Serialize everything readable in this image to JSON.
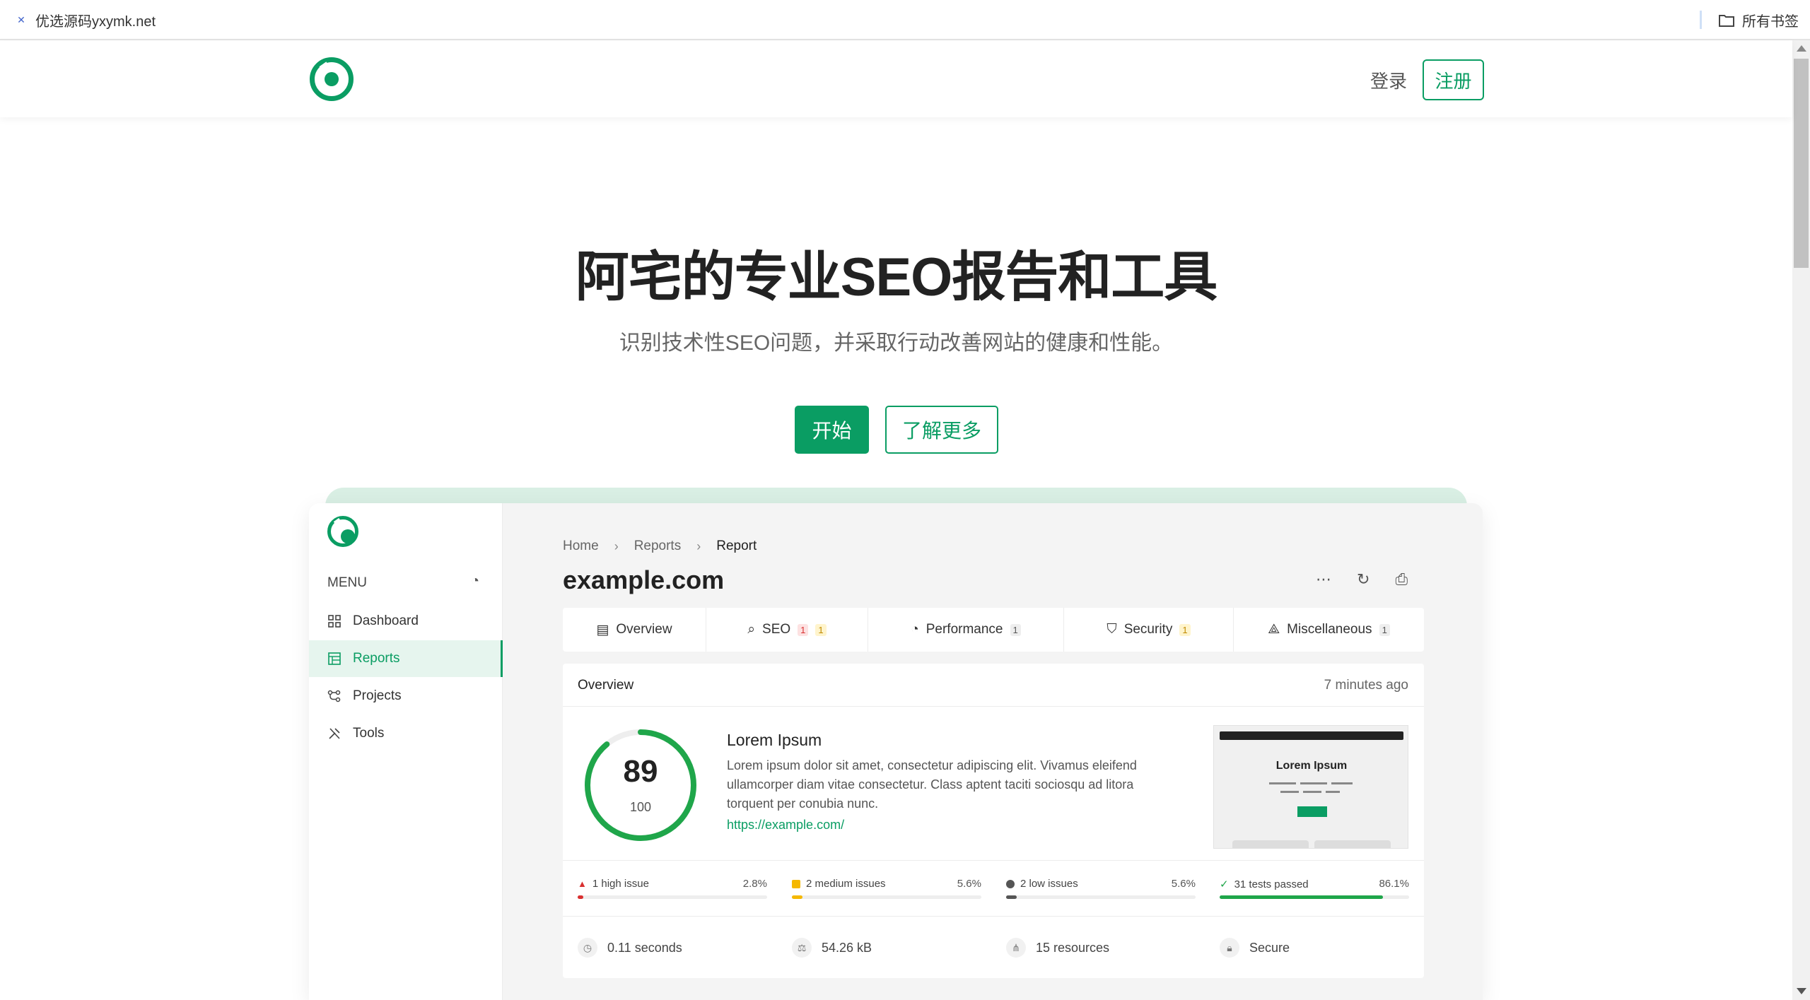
{
  "browser": {
    "bookmark_label": "优选源码yxymk.net",
    "bookmark_icon": "site-favicon",
    "all_bookmarks_label": "所有书签"
  },
  "header": {
    "login_label": "登录",
    "register_label": "注册"
  },
  "hero": {
    "title": "阿宅的专业SEO报告和工具",
    "subtitle": "识别技术性SEO问题，并采取行动改善网站的健康和性能。",
    "start_label": "开始",
    "more_label": "了解更多"
  },
  "app": {
    "menu_label": "MENU",
    "sidebar": [
      {
        "label": "Dashboard",
        "icon": "dashboard-icon"
      },
      {
        "label": "Reports",
        "icon": "reports-icon",
        "active": true
      },
      {
        "label": "Projects",
        "icon": "projects-icon"
      },
      {
        "label": "Tools",
        "icon": "tools-icon"
      }
    ],
    "breadcrumb": [
      "Home",
      "Reports",
      "Report"
    ],
    "page_title": "example.com",
    "tabs": [
      {
        "label": "Overview",
        "icon": "overview-icon",
        "badges": []
      },
      {
        "label": "SEO",
        "icon": "search-icon",
        "badges": [
          "1",
          "1"
        ]
      },
      {
        "label": "Performance",
        "icon": "gauge-icon",
        "badges": [
          "1"
        ]
      },
      {
        "label": "Security",
        "icon": "shield-icon",
        "badges": [
          "1"
        ]
      },
      {
        "label": "Miscellaneous",
        "icon": "shapes-icon",
        "badges": [
          "1"
        ]
      }
    ],
    "overview": {
      "title": "Overview",
      "time": "7 minutes ago",
      "score": "89",
      "score_max": "100",
      "score_fraction": 0.89,
      "site_name": "Lorem Ipsum",
      "site_desc": "Lorem ipsum dolor sit amet, consectetur adipiscing elit. Vivamus eleifend ullamcorper diam vitae consectetur. Class aptent taciti sociosqu ad litora torquent per conubia nunc.",
      "site_url": "https://example.com/",
      "thumb_title": "Lorem Ipsum",
      "issues": [
        {
          "label": "1 high issue",
          "pct": "2.8%",
          "value": 2.8,
          "color": "#d93030"
        },
        {
          "label": "2 medium issues",
          "pct": "5.6%",
          "value": 5.6,
          "color": "#f5b800"
        },
        {
          "label": "2 low issues",
          "pct": "5.6%",
          "value": 5.6,
          "color": "#555555"
        },
        {
          "label": "31 tests passed",
          "pct": "86.1%",
          "value": 86.1,
          "color": "#1fa64a"
        }
      ],
      "stats": [
        {
          "label": "0.11 seconds",
          "icon": "timer-icon"
        },
        {
          "label": "54.26 kB",
          "icon": "scale-icon"
        },
        {
          "label": "15 resources",
          "icon": "network-icon"
        },
        {
          "label": "Secure",
          "icon": "lock-icon"
        }
      ]
    }
  },
  "colors": {
    "brand": "#0a9d63",
    "score_ring": "#1fa64a"
  }
}
